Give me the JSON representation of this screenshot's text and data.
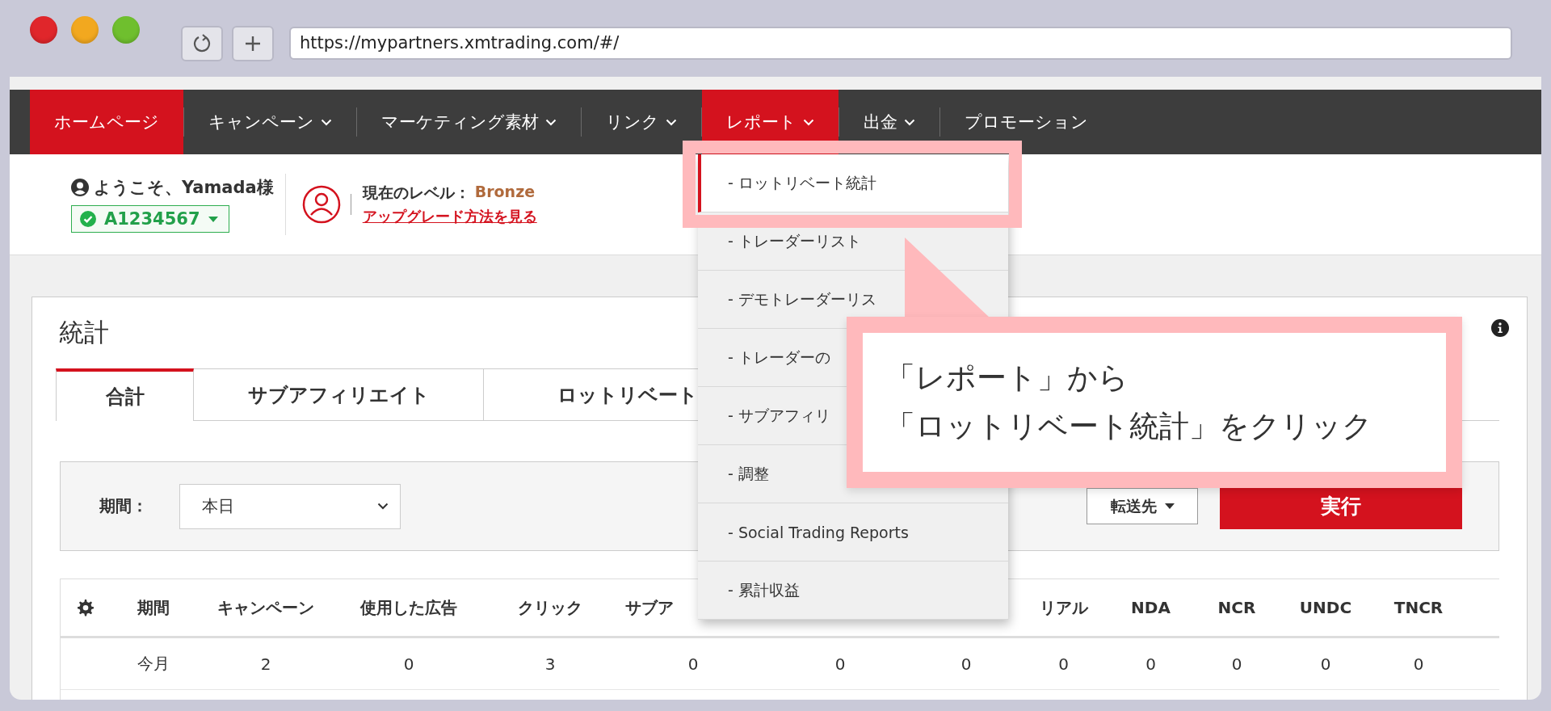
{
  "browser": {
    "url": "https://mypartners.xmtrading.com/#/"
  },
  "nav": [
    {
      "label": "ホームページ",
      "selected": true,
      "dropdown": false
    },
    {
      "label": "キャンペーン",
      "selected": false,
      "dropdown": true
    },
    {
      "label": "マーケティング素材",
      "selected": false,
      "dropdown": true
    },
    {
      "label": "リンク",
      "selected": false,
      "dropdown": true
    },
    {
      "label": "レポート",
      "selected": true,
      "dropdown": true
    },
    {
      "label": "出金",
      "selected": false,
      "dropdown": true
    },
    {
      "label": "プロモーション",
      "selected": false,
      "dropdown": false
    }
  ],
  "header": {
    "welcome": "ようこそ、Yamada様",
    "account": "A1234567",
    "level_label": "現在のレベル：",
    "level": "Bronze",
    "upgrade_link": "アップグレード方法を見る"
  },
  "dropdown": {
    "items": [
      {
        "label": "- ロットリベート統計",
        "selected": true
      },
      {
        "label": "- トレーダーリスト",
        "selected": false
      },
      {
        "label": "- デモトレーダーリス",
        "selected": false
      },
      {
        "label": "- トレーダーの",
        "selected": false
      },
      {
        "label": "- サブアフィリ",
        "selected": false
      },
      {
        "label": "- 調整",
        "selected": false
      },
      {
        "label": "- Social Trading Reports",
        "selected": false
      },
      {
        "label": "- 累計収益",
        "selected": false
      }
    ]
  },
  "callout": {
    "lines": [
      "「レポート」から",
      "「ロットリベート統計」をクリック"
    ]
  },
  "stats": {
    "title": "統計",
    "tabs": [
      {
        "label": "合計",
        "selected": true
      },
      {
        "label": "サブアフィリエイト",
        "selected": false
      },
      {
        "label": "ロットリベート",
        "selected": false
      }
    ],
    "filter": {
      "label": "期間：",
      "select": "本日",
      "forward_button": "転送先",
      "run_button": "実行"
    },
    "table": {
      "columns": [
        {
          "label": "期間"
        },
        {
          "label": "キャンペーン"
        },
        {
          "label": "使用した広告"
        },
        {
          "label": "クリック"
        },
        {
          "label": "サブア"
        },
        {},
        {},
        {
          "label": "リアル"
        },
        {
          "label": "NDA"
        },
        {
          "label": "NCR"
        },
        {
          "label": "UNDC"
        },
        {
          "label": "TNCR"
        }
      ],
      "rows": [
        [
          "今月",
          "2",
          "0",
          "3",
          "0",
          "0",
          "0",
          "0",
          "0",
          "0",
          "0",
          "0"
        ]
      ]
    }
  }
}
